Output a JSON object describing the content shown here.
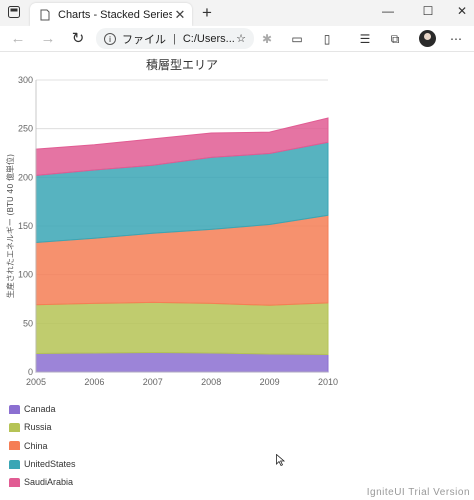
{
  "browser": {
    "tab_title": "Charts - Stacked Series",
    "tab_close": "✕",
    "new_tab": "+",
    "address_scheme": "ファイル",
    "address_separator": "|",
    "address_url": "C:/Users...",
    "window_controls": {
      "minimize": "—",
      "maximize": "☐",
      "close": "✕"
    }
  },
  "chart_data": {
    "type": "area",
    "stacked": true,
    "title": "積層型エリア",
    "xlabel": "",
    "ylabel": "生産されたエネルギー (BTU 40 億単位)",
    "x": [
      "2005",
      "2006",
      "2007",
      "2008",
      "2009",
      "2010"
    ],
    "ylim": [
      0,
      300
    ],
    "yticks": [
      "0",
      "50",
      "100",
      "150",
      "200",
      "250",
      "300"
    ],
    "grid": true,
    "legend_position": "bottom-left",
    "series": [
      {
        "name": "Canada",
        "color": "#8b6fd1",
        "values": [
          19,
          19.5,
          20,
          19.5,
          18.5,
          18
        ]
      },
      {
        "name": "Russia",
        "color": "#b5c355",
        "values": [
          50,
          51,
          51.5,
          51,
          50,
          53
        ]
      },
      {
        "name": "China",
        "color": "#f57e55",
        "values": [
          64,
          67,
          71,
          76,
          83,
          90
        ]
      },
      {
        "name": "UnitedStates",
        "color": "#3aa6b5",
        "values": [
          69,
          70,
          70,
          74,
          73,
          75
        ]
      },
      {
        "name": "SaudiArabia",
        "color": "#e15c93",
        "values": [
          27,
          26,
          27,
          25,
          22,
          25
        ]
      }
    ]
  },
  "footer": "IgniteUI Trial Version"
}
